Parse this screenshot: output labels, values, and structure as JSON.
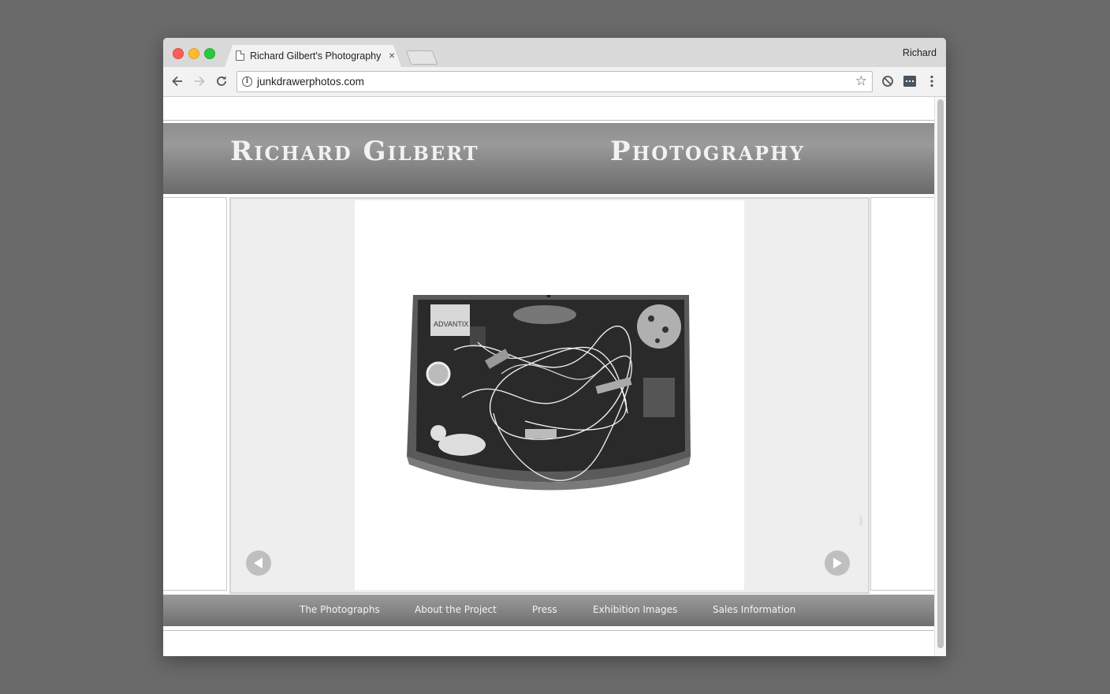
{
  "browser": {
    "tab_title": "Richard Gilbert's Photography",
    "tab_close": "×",
    "profile_name": "Richard",
    "url": "junkdrawerphotos.com",
    "info_glyph": "i",
    "star_glyph": "☆"
  },
  "site": {
    "title_left": "Richard Gilbert",
    "title_right": "Photography"
  },
  "slideshow": {
    "image_label": "ADVANTIX",
    "image_subject": "junk-drawer-photo",
    "prev_icon": "triangle-left-icon",
    "next_icon": "triangle-right-icon"
  },
  "nav": {
    "items": [
      {
        "label": "The Photographs"
      },
      {
        "label": "About the Project"
      },
      {
        "label": "Press"
      },
      {
        "label": "Exhibition Images"
      },
      {
        "label": "Sales Information"
      }
    ]
  },
  "colors": {
    "page_background": "#6a6a6a",
    "header_band": "#7f7f7f",
    "slideshow_bg": "#eeeeee"
  }
}
